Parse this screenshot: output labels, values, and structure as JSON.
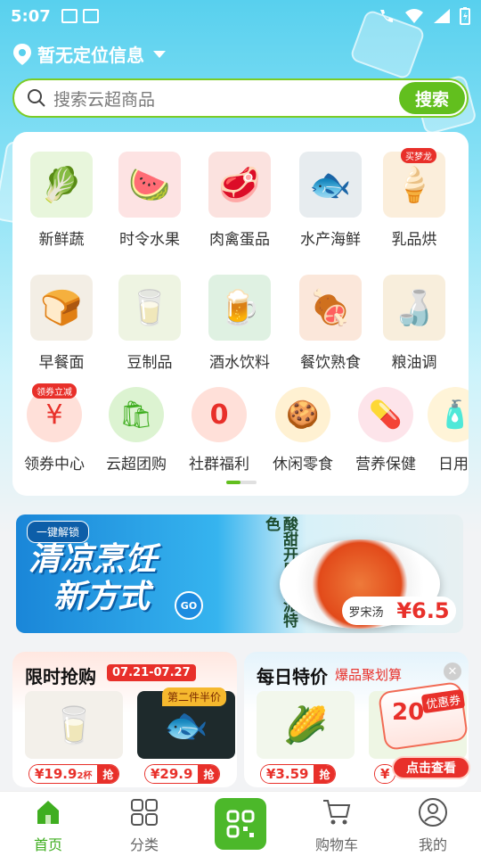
{
  "status_bar": {
    "time": "5:07"
  },
  "header": {
    "location_text": "暂无定位信息",
    "search_placeholder": "搜索云超商品",
    "search_button": "搜索"
  },
  "categories": [
    {
      "label": "新鲜蔬",
      "icon": "vegetable-icon"
    },
    {
      "label": "时令水果",
      "icon": "watermelon-icon"
    },
    {
      "label": "肉禽蛋品",
      "icon": "meat-icon"
    },
    {
      "label": "水产海鲜",
      "icon": "fish-icon"
    },
    {
      "label": "乳品烘",
      "icon": "icecream-icon",
      "badge": "买梦龙"
    },
    {
      "label": "早餐面",
      "icon": "bread-icon"
    },
    {
      "label": "豆制品",
      "icon": "soymilk-icon"
    },
    {
      "label": "酒水饮料",
      "icon": "beer-icon"
    },
    {
      "label": "餐饮熟食",
      "icon": "cooked-food-icon"
    },
    {
      "label": "粮油调",
      "icon": "oil-icon"
    },
    {
      "label": "领券中心",
      "icon": "coupon-icon",
      "badge": "领券立减"
    },
    {
      "label": "云超团购",
      "icon": "groupbuy-icon"
    },
    {
      "label": "社群福利",
      "icon": "zero-yuan-icon"
    },
    {
      "label": "休闲零食",
      "icon": "snack-icon"
    },
    {
      "label": "营养保健",
      "icon": "supplement-icon"
    },
    {
      "label": "日用",
      "icon": "daily-goods-icon"
    }
  ],
  "banner": {
    "tag": "一键解锁",
    "headline_line1": "清凉烹饪",
    "headline_line2": "新方式",
    "side_text": "酸甜开胃 海派特色",
    "go": "GO",
    "dish_name": "罗宋汤",
    "price": "¥6.5"
  },
  "flash_sale": {
    "title": "限时抢购",
    "date_range": "07.21-07.27",
    "half_off_badge": "第二件半价",
    "products": [
      {
        "price": "¥19.9",
        "unit": "2杯",
        "grab": "抢",
        "icon": "yogurt-cup-icon"
      },
      {
        "price": "¥29.9",
        "unit": "",
        "grab": "抢",
        "icon": "pomfret-fish-icon"
      }
    ]
  },
  "daily_special": {
    "title": "每日特价",
    "subtitle": "爆品聚划算",
    "products": [
      {
        "price": "¥3.59",
        "grab": "抢",
        "icon": "corn-icon"
      },
      {
        "price": "¥",
        "grab": "",
        "icon": "vegetable-icon"
      }
    ]
  },
  "coupon_float": {
    "amount": "20",
    "title": "优惠券",
    "action": "点击查看"
  },
  "tabbar": {
    "tabs": [
      {
        "label": "首页",
        "icon": "home-icon",
        "active": true
      },
      {
        "label": "分类",
        "icon": "grid-icon",
        "active": false
      },
      {
        "label": "",
        "icon": "qr-scan-icon",
        "active": false
      },
      {
        "label": "购物车",
        "icon": "cart-icon",
        "active": false
      },
      {
        "label": "我的",
        "icon": "user-icon",
        "active": false
      }
    ]
  },
  "colors": {
    "accent_green": "#62bf1e",
    "sale_red": "#e8302a",
    "sky_blue": "#58d0ee"
  }
}
